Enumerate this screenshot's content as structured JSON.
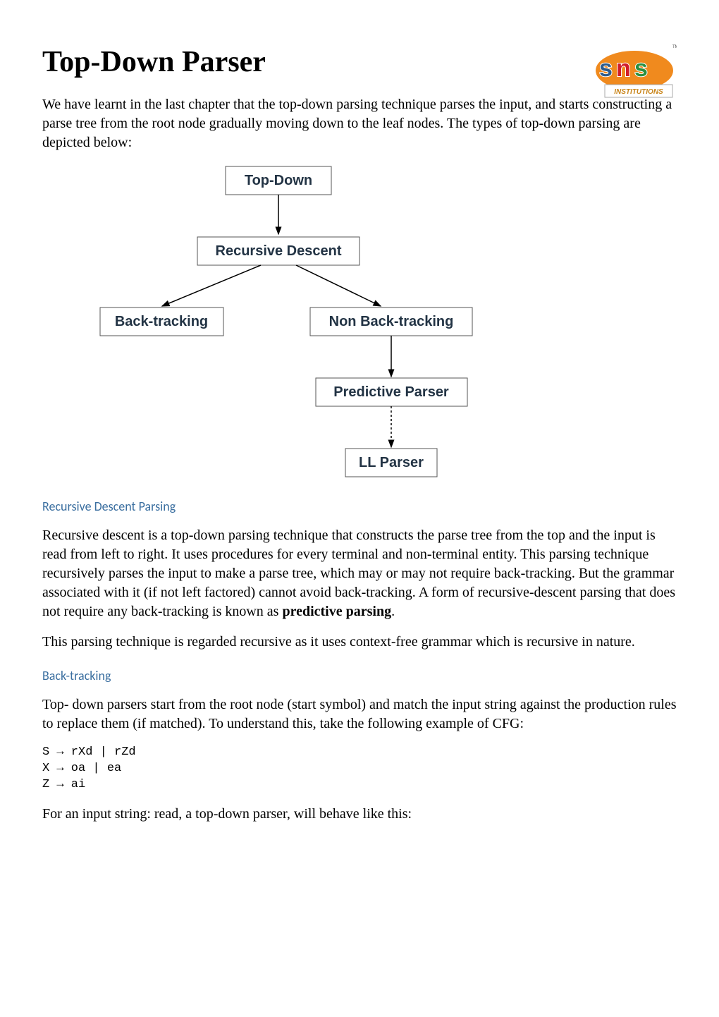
{
  "title": "Top-Down Parser",
  "logo": {
    "text_top": "sns",
    "text_bottom": "INSTITUTIONS",
    "tm": "TM"
  },
  "intro": "We have learnt in the last chapter that the top-down parsing technique parses the input, and starts constructing a parse tree from the root node gradually moving down to the leaf nodes. The types of top-down parsing are depicted below:",
  "diagram": {
    "nodes": {
      "top_down": "Top-Down",
      "recursive_descent": "Recursive Descent",
      "back_tracking": "Back-tracking",
      "non_back_tracking": "Non Back-tracking",
      "predictive_parser": "Predictive Parser",
      "ll_parser": "LL Parser"
    }
  },
  "section1": {
    "heading": "Recursive Descent Parsing",
    "para1_before": "Recursive descent is a top-down parsing technique that constructs the parse tree from the top and the input is read from left to right. It uses procedures for every terminal and non-terminal entity. This parsing technique recursively parses the input to make a parse tree, which may or may not require back-tracking. But the grammar associated with it (if not left factored) cannot avoid back-tracking. A form of recursive-descent parsing that does not require any back-tracking is known as ",
    "para1_bold": "predictive parsing",
    "para1_after": ".",
    "para2": "This parsing technique is regarded recursive as it uses context-free grammar which is recursive in nature."
  },
  "section2": {
    "heading": "Back-tracking",
    "para1": "Top- down parsers start from the root node (start symbol) and match the input string against the production rules to replace them (if matched). To understand this, take the following example of CFG:",
    "code": "S → rXd | rZd\nX → oa | ea\nZ → ai",
    "para2": "For an input string: read, a top-down parser, will behave like this:"
  }
}
